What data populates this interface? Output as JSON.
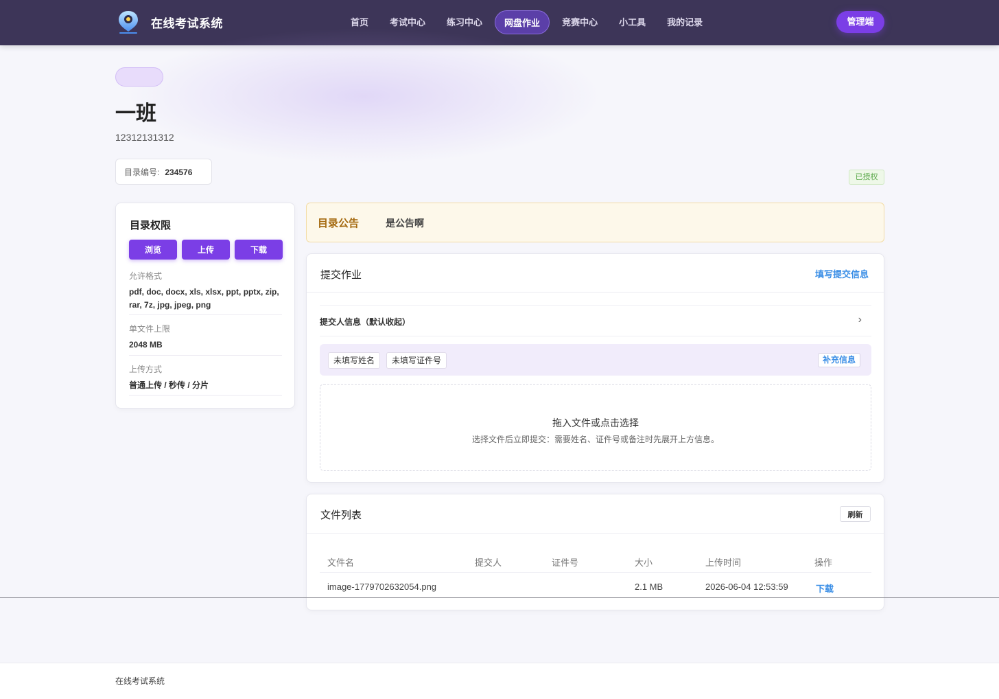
{
  "brand": {
    "title": "在线考试系统",
    "logo": "pin-shield-logo"
  },
  "nav": {
    "items": [
      {
        "label": "首页"
      },
      {
        "label": "考试中心"
      },
      {
        "label": "练习中心"
      },
      {
        "label": "网盘作业",
        "active": true
      },
      {
        "label": "竞赛中心"
      },
      {
        "label": "小工具"
      },
      {
        "label": "我的记录"
      }
    ],
    "admin_label": "管理端"
  },
  "hero": {
    "title": "一班",
    "description": "12312131312",
    "dir_no_label": "目录编号:",
    "dir_no_value": "234576",
    "auth_tag": "已授权"
  },
  "permissions": {
    "title": "目录权限",
    "buttons": [
      "浏览",
      "上传",
      "下载"
    ],
    "formats_label": "允许格式",
    "formats_value": "pdf, doc, docx, xls, xlsx, ppt, pptx, zip, rar, 7z, jpg, jpeg, png",
    "size_label": "单文件上限",
    "size_value": "2048 MB",
    "mode_label": "上传方式",
    "mode_value": "普通上传 / 秒传 / 分片"
  },
  "announcement": {
    "label": "目录公告",
    "text": "是公告啊"
  },
  "submit": {
    "title": "提交作业",
    "fill_link": "填写提交信息",
    "info_row_label": "提交人信息（默认收起）",
    "missing_chips": [
      "未填写姓名",
      "未填写证件号"
    ],
    "supplement_button": "补充信息",
    "dropzone_title": "拖入文件或点击选择",
    "dropzone_sub": "选择文件后立即提交：需要姓名、证件号或备注时先展开上方信息。"
  },
  "files": {
    "title": "文件列表",
    "refresh_label": "刷新",
    "columns": [
      "文件名",
      "提交人",
      "证件号",
      "大小",
      "上传时间",
      "操作"
    ],
    "rows": [
      {
        "name": "image-1779702632054.png",
        "submitter": "",
        "id_no": "",
        "size": "2.1 MB",
        "time": "2026-06-04 12:53:59",
        "action": "下载"
      }
    ]
  },
  "footer": {
    "text": "在线考试系统"
  },
  "colors": {
    "nav_bg": "#3d3558",
    "accent": "#7b3ee6",
    "link": "#3a8ee6"
  }
}
